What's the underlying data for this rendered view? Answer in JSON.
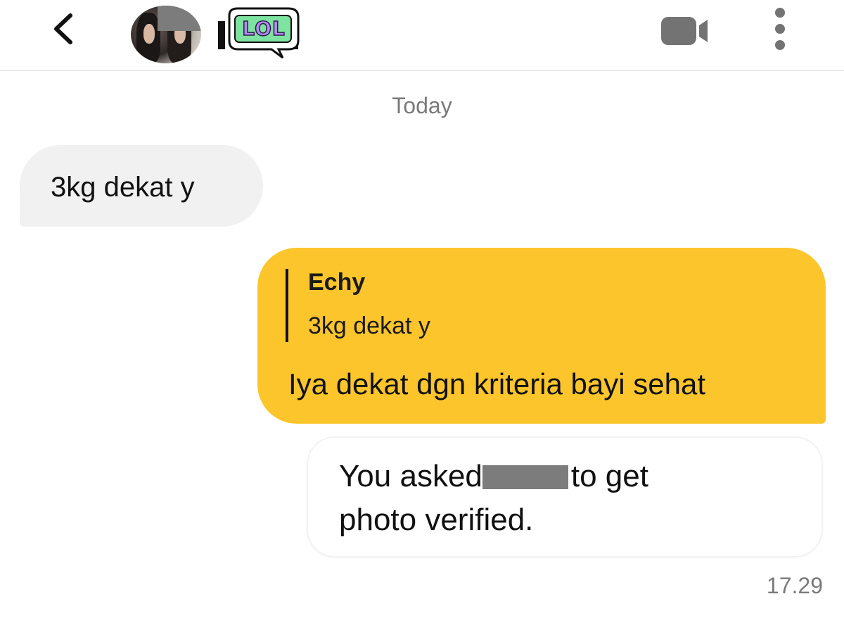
{
  "header": {
    "back_icon": "chevron-left-icon",
    "avatar_icon": "profile-photo-icon",
    "sticker_text": "LOL",
    "video_icon": "video-camera-icon",
    "more_icon": "more-vertical-icon"
  },
  "messages": {
    "date_separator": "Today",
    "incoming_text": "3kg dekat y",
    "outgoing": {
      "quote_sender": "Echy",
      "quote_text": "3kg dekat y",
      "reply_text": "Iya dekat dgn kriteria bayi sehat"
    },
    "system": {
      "line1_before": "You asked",
      "line1_after": "to get",
      "line2": "photo verified."
    },
    "time": "17.29"
  },
  "colors": {
    "outgoing_bubble": "#fcc52c",
    "incoming_bubble": "#f1f1f1",
    "muted_text": "#7a7a7a",
    "redaction": "#7c7c7c",
    "sticker_purple": "#b48cf0",
    "sticker_green": "#7ee3a0"
  }
}
